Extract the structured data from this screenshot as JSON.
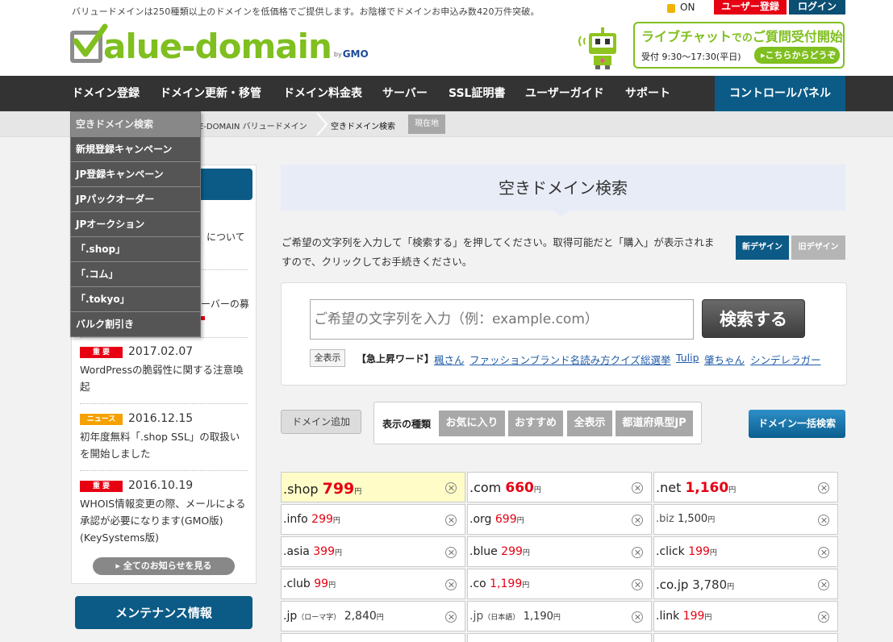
{
  "header": {
    "tagline": "バリュードメインは250種類以上のドメインを低価格でご提供します。お陰様でドメインお申込み数420万件突破。",
    "logo_text": "alue-domain",
    "logo_by": "by",
    "logo_gmo": "GMO",
    "ssl_on": "ON",
    "register_label": "ユーザー登録",
    "login_label": "ログイン",
    "chat": {
      "title_main": "ライブチャット",
      "title_mid": "での",
      "title_end": "ご質問受付開始",
      "hours": "受付 9:30〜17:30(平日)",
      "link": "▸こちらからどうぞ"
    }
  },
  "nav": {
    "items": [
      "ドメイン登録",
      "ドメイン更新・移管",
      "ドメイン料金表",
      "サーバー",
      "SSL証明書",
      "ユーザーガイド",
      "サポート"
    ],
    "control_panel": "コントロールパネル"
  },
  "breadcrumb": {
    "home": "E-DOMAIN バリュードメイン",
    "current": "空きドメイン検索",
    "here": "現在地"
  },
  "dropdown": {
    "items": [
      "空きドメイン検索",
      "新規登録キャンペーン",
      "JP登録キャンペーン",
      "JPパックオーダー",
      "JPオークション",
      "「.shop」",
      "「.コム」",
      "「.tokyo」",
      "バルク割引き"
    ]
  },
  "sidebar": {
    "frag1": "について",
    "frag2": "ーバーの募",
    "news": [
      {
        "badge": "重 要",
        "date": "2017.02.07",
        "text": "WordPressの脆弱性に関する注意喚起"
      },
      {
        "badge": "ニュース",
        "date": "2016.12.15",
        "text": "初年度無料「.shop SSL」の取扱いを開始しました"
      },
      {
        "badge": "重 要",
        "date": "2016.10.19",
        "text": "WHOIS情報変更の際、メールによる承認が必要になります(GMO版)(KeySystems版)"
      }
    ],
    "all_news": "▸ 全てのお知らせを見る",
    "maintenance": "メンテナンス情報"
  },
  "main": {
    "title": "空きドメイン検索",
    "desc": "ご希望の文字列を入力して「検索する」を押してください。取得可能だと「購入」が表示されますので、クリックしてお手続きください。",
    "new_design": "新デザイン",
    "old_design": "旧デザイン",
    "search_placeholder": "ご希望の文字列を入力（例：example.com）",
    "search_button": "検索する",
    "show_all": "全表示",
    "trend_label": "【急上昇ワード】",
    "trends": [
      "楓さん",
      "ファッションブランド名読み方クイズ",
      "総選挙",
      "Tulip",
      "肇ちゃん",
      "シンデレラガー"
    ],
    "add_domain": "ドメイン追加",
    "type_label": "表示の種類",
    "types": [
      "お気に入り",
      "おすすめ",
      "全表示",
      "都道府県型JP"
    ],
    "bulk_search": "ドメイン一括検索"
  },
  "domains": [
    {
      "name": ".shop",
      "price": "799",
      "yen": "円"
    },
    {
      "name": ".com",
      "price": "660",
      "yen": "円"
    },
    {
      "name": ".net",
      "price": "1,160",
      "yen": "円"
    },
    {
      "name": ".info",
      "price": "299",
      "yen": "円"
    },
    {
      "name": ".org",
      "price": "699",
      "yen": "円"
    },
    {
      "name": ".biz",
      "price": "1,500",
      "yen": "円"
    },
    {
      "name": ".asia",
      "price": "399",
      "yen": "円"
    },
    {
      "name": ".blue",
      "price": "299",
      "yen": "円"
    },
    {
      "name": ".click",
      "price": "199",
      "yen": "円"
    },
    {
      "name": ".club",
      "price": "99",
      "yen": "円"
    },
    {
      "name": ".co",
      "price": "1,199",
      "yen": "円"
    },
    {
      "name": ".co.jp",
      "price": "3,780",
      "yen": "円"
    },
    {
      "name": ".jp",
      "note": "（ローマ字）",
      "price": "2,840",
      "yen": "円"
    },
    {
      "name": ".jp",
      "note": "（日本語）",
      "price": "1,190",
      "yen": "円"
    },
    {
      "name": ".link",
      "price": "199",
      "yen": "円"
    }
  ],
  "colors": {
    "brand_green": "#7fbf1f",
    "nav_dark": "#333333",
    "accent_blue": "#0b5b86",
    "price_red": "#e60012"
  }
}
